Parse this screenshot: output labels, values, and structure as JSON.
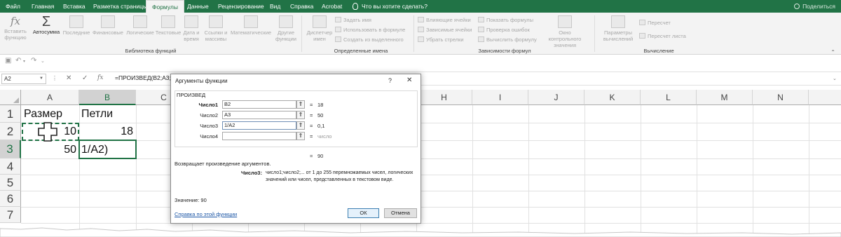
{
  "tabs": [
    {
      "label": "Файл"
    },
    {
      "label": "Главная"
    },
    {
      "label": "Вставка"
    },
    {
      "label": "Разметка страницы"
    },
    {
      "label": "Формулы",
      "active": true
    },
    {
      "label": "Данные"
    },
    {
      "label": "Рецензирование"
    },
    {
      "label": "Вид"
    },
    {
      "label": "Справка"
    },
    {
      "label": "Acrobat"
    }
  ],
  "tell_me": "Что вы хотите сделать?",
  "share": "Поделиться",
  "ribbon": {
    "insert_function": "Вставить функцию",
    "library": [
      "Автосумма",
      "Последние",
      "Финансовые",
      "Логические",
      "Текстовые",
      "Дата и время",
      "Ссылки и массивы",
      "Математические",
      "Другие функции"
    ],
    "library_label": "Библиотека функций",
    "name_manager": "Диспетчер имен",
    "names_items": [
      "Задать имя",
      "Использовать в формуле",
      "Создать из выделенного"
    ],
    "names_label": "Определенные имена",
    "audit_items": [
      "Влияющие ячейки",
      "Зависимые ячейки",
      "Убрать стрелки",
      "Показать формулы",
      "Проверка ошибок",
      "Вычислить формулу"
    ],
    "watch": "Окно контрольного значения",
    "audit_label": "Зависимости формул",
    "calc_options": "Параметры вычислений",
    "calc_items": [
      "Пересчет",
      "Пересчет листа"
    ],
    "calc_label": "Вычисление"
  },
  "formula_bar": {
    "name_box": "A2",
    "formula": "=ПРОИЗВЕД(B2;A3;1/A2)"
  },
  "grid": {
    "columns": [
      "A",
      "B",
      "C",
      "D",
      "E",
      "F",
      "G",
      "H",
      "I",
      "J",
      "K",
      "L",
      "M",
      "N"
    ],
    "rows": [
      "1",
      "2",
      "3",
      "4",
      "5",
      "6",
      "7"
    ],
    "cells": {
      "A1": "Размер",
      "B1": "Петли",
      "A2": "10",
      "B2": "18",
      "A3": "50",
      "B3": "1/A2)"
    }
  },
  "dialog": {
    "title": "Аргументы функции",
    "help": "?",
    "close": "✕",
    "function_name": "ПРОИЗВЕД",
    "args": [
      {
        "label": "Число1",
        "value": "B2",
        "result": "18",
        "bold": true
      },
      {
        "label": "Число2",
        "value": "A3",
        "result": "50"
      },
      {
        "label": "Число3",
        "value": "1/A2",
        "result": "0,1"
      },
      {
        "label": "Число4",
        "value": "",
        "result": "число"
      }
    ],
    "total": "90",
    "description": "Возвращает произведение аргументов.",
    "arg_name": "Число3:",
    "arg_description": "число1;число2;... от 1 до 255 перемножаемых чисел, логических значений или чисел, представленных в текстовом виде.",
    "value_label": "Значение:  90",
    "help_link": "Справка по этой функции",
    "ok": "ОК",
    "cancel": "Отмена"
  }
}
